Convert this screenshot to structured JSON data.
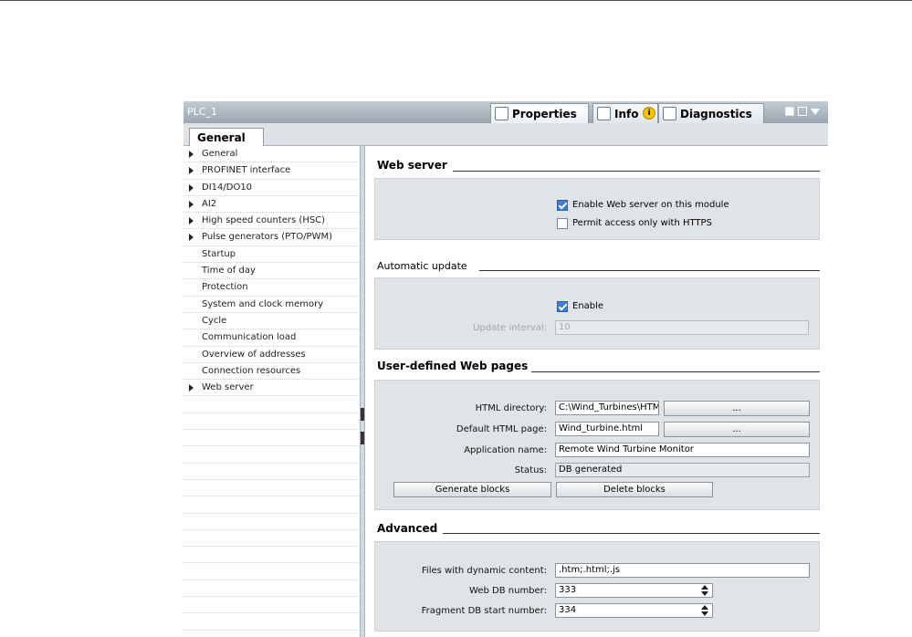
{
  "window": {
    "title": "PLC_1",
    "tabs": [
      {
        "label": "Properties",
        "icon": "properties-icon"
      },
      {
        "label": "Info",
        "icon": "info-icon",
        "badge": "i"
      },
      {
        "label": "Diagnostics",
        "icon": "diagnostics-icon"
      }
    ]
  },
  "section_tab": "General",
  "nav": {
    "items": [
      {
        "label": "General",
        "expandable": true
      },
      {
        "label": "PROFINET interface",
        "expandable": true
      },
      {
        "label": "DI14/DO10",
        "expandable": true
      },
      {
        "label": "AI2",
        "expandable": true
      },
      {
        "label": "High speed counters (HSC)",
        "expandable": true
      },
      {
        "label": "Pulse generators (PTO/PWM)",
        "expandable": true
      },
      {
        "label": "Startup",
        "expandable": false
      },
      {
        "label": "Time of day",
        "expandable": false
      },
      {
        "label": "Protection",
        "expandable": false
      },
      {
        "label": "System and clock memory",
        "expandable": false
      },
      {
        "label": "Cycle",
        "expandable": false
      },
      {
        "label": "Communication load",
        "expandable": false
      },
      {
        "label": "Overview of addresses",
        "expandable": false
      },
      {
        "label": "Connection resources",
        "expandable": false
      },
      {
        "label": "Web server",
        "expandable": true
      }
    ]
  },
  "web_server": {
    "title": "Web server",
    "enable_label": "Enable Web server on this module",
    "enable_checked": true,
    "https_label": "Permit access only with HTTPS",
    "https_checked": false
  },
  "automatic_update": {
    "title": "Automatic update",
    "enable_label": "Enable",
    "enable_checked": true,
    "interval_label": "Update interval:",
    "interval_value": "10"
  },
  "user_pages": {
    "title": "User-defined Web pages",
    "html_dir_label": "HTML directory:",
    "html_dir_value": "C:\\Wind_Turbines\\HTM",
    "browse_label": "...",
    "default_page_label": "Default HTML page:",
    "default_page_value": "Wind_turbine.html",
    "app_name_label": "Application name:",
    "app_name_value": "Remote Wind Turbine Monitor",
    "status_label": "Status:",
    "status_value": "DB generated",
    "generate_label": "Generate blocks",
    "delete_label": "Delete blocks"
  },
  "advanced": {
    "title": "Advanced",
    "dynamic_label": "Files with dynamic content:",
    "dynamic_value": ".htm;.html;.js",
    "web_db_label": "Web DB number:",
    "web_db_value": "333",
    "fragment_label": "Fragment DB start number:",
    "fragment_value": "334"
  }
}
